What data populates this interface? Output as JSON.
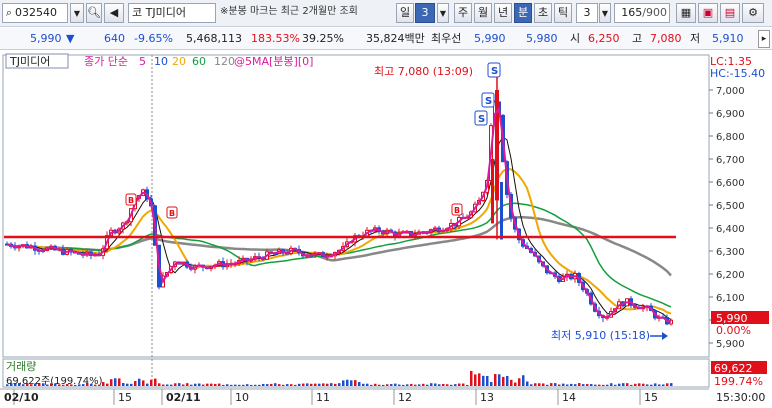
{
  "toolbar": {
    "code": "032540",
    "market_label": "코",
    "stock_name": "TJ미디어",
    "notice": "※분봉 마크는 최근 2개월만 조회",
    "period_unit": "일",
    "period_value": "3",
    "tabs": [
      "주",
      "월",
      "년",
      "분",
      "초",
      "틱"
    ],
    "selected_tab": "분",
    "interval": "3",
    "count": "165",
    "count_total": "/900"
  },
  "quote": {
    "price": "5,990",
    "change_arrow": "▼",
    "change": "640",
    "change_rate": "-9.65%",
    "volume": "5,468,113",
    "volume_ratio": "183.53%",
    "turnover": "39.25%",
    "amount": "35,824백만",
    "sell_label": "최우선",
    "ask": "5,990",
    "bid": "5,980",
    "open_label": "시",
    "open": "6,250",
    "high_label": "고",
    "high": "7,080",
    "low_label": "저",
    "low": "5,910"
  },
  "chart": {
    "legend_name": "TJ미디어",
    "ma_label": "종가 단순",
    "ma_periods": [
      "5",
      "10",
      "20",
      "60",
      "120"
    ],
    "ma_colors": [
      "#d81b9c",
      "#111111",
      "#f0a800",
      "#12a03c",
      "#888888"
    ],
    "ma5_extra": "@5MA[분봉][0]",
    "high_annotation": "최고 7,080 (13:09)",
    "low_annotation": "최저 5,910 (15:18)",
    "lc": "LC:1.35",
    "hc": "HC:-15.40",
    "price_ticks": [
      "7,000",
      "6,900",
      "6,800",
      "6,700",
      "6,600",
      "6,500",
      "6,400",
      "6,300",
      "6,200",
      "6,100",
      "6,000",
      "5,900"
    ],
    "current_price_tag": "5,990",
    "current_rate_tag": "0.00%",
    "volume_title": "거래량",
    "volume_value": "69,622주(199.74%)",
    "volume_tag": "69,622",
    "volume_rate_tag": "199.74%",
    "x_labels": [
      "02/10",
      "15",
      "02/11",
      "10",
      "11",
      "12",
      "13",
      "14",
      "15"
    ],
    "time_label": "15:30:00",
    "colors": {
      "up": "#e0101a",
      "down": "#1c4fd0",
      "resistance": "#e0101a"
    }
  }
}
